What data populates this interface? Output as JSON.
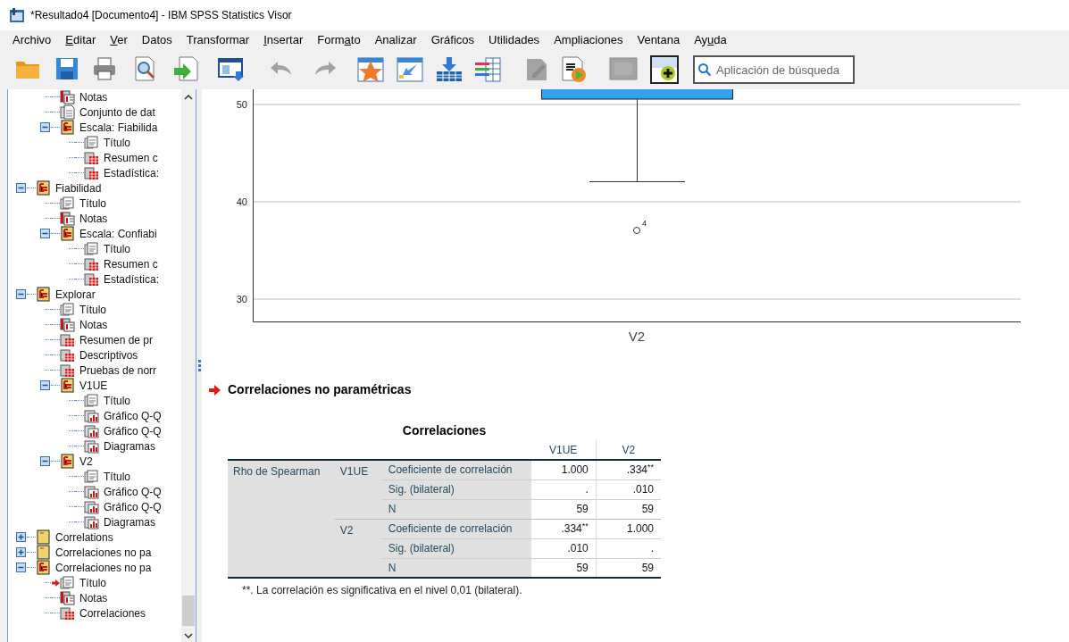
{
  "window": {
    "title": "*Resultado4 [Documento4] - IBM SPSS Statistics Visor"
  },
  "menu": [
    {
      "before": "Archivo"
    },
    {
      "key": "E",
      "after": "ditar"
    },
    {
      "key": "V",
      "after": "er"
    },
    {
      "before": "Datos"
    },
    {
      "before": "Transformar"
    },
    {
      "key": "I",
      "after": "nsertar"
    },
    {
      "before": "Form",
      "key": "a",
      "after": "to"
    },
    {
      "before": "Analizar"
    },
    {
      "before": "Gráficos"
    },
    {
      "before": "Utilidades"
    },
    {
      "before": "Ampliaciones"
    },
    {
      "before": "Ventana"
    },
    {
      "before": "Ay",
      "key": "u",
      "after": "da"
    }
  ],
  "toolbar": [
    {
      "kind": "open",
      "disabled": false
    },
    {
      "kind": "save",
      "disabled": false
    },
    {
      "kind": "print",
      "disabled": false
    },
    {
      "kind": "preview",
      "disabled": false
    },
    {
      "kind": "export",
      "disabled": false
    },
    {
      "kind": "window",
      "disabled": false
    },
    {
      "kind": "undo",
      "disabled": true
    },
    {
      "kind": "redo",
      "disabled": true
    },
    {
      "kind": "star",
      "disabled": false
    },
    {
      "kind": "goto",
      "disabled": false
    },
    {
      "kind": "insert",
      "disabled": false
    },
    {
      "kind": "variables",
      "disabled": false
    },
    {
      "kind": "edit",
      "disabled": true
    },
    {
      "kind": "script",
      "disabled": false
    },
    {
      "kind": "square",
      "disabled": true
    },
    {
      "kind": "add",
      "disabled": false
    }
  ],
  "search": {
    "placeholder": "Aplicación de búsqueda"
  },
  "tree": {
    "continued": [
      {
        "label": "Notas",
        "kind": "notes",
        "current": false
      },
      {
        "label": "Conjunto de dat",
        "kind": "page",
        "current": false
      },
      {
        "label": "Escala: Fiabilida",
        "kind": "node",
        "expanded": true,
        "current": false,
        "children": [
          {
            "label": "Título",
            "kind": "title",
            "current": false
          },
          {
            "label": "Resumen c",
            "kind": "table",
            "current": false
          },
          {
            "label": "Estadística:",
            "kind": "table",
            "current": false
          }
        ]
      }
    ],
    "nodes": [
      {
        "label": "Fiabilidad",
        "kind": "node",
        "expanded": true,
        "current": false,
        "children": [
          {
            "label": "Título",
            "kind": "title",
            "current": false
          },
          {
            "label": "Notas",
            "kind": "notes",
            "current": false
          },
          {
            "label": "Escala: Confiabi",
            "kind": "node",
            "expanded": true,
            "current": false,
            "children": [
              {
                "label": "Título",
                "kind": "title",
                "current": false
              },
              {
                "label": "Resumen c",
                "kind": "table",
                "current": false
              },
              {
                "label": "Estadística:",
                "kind": "table",
                "current": false
              }
            ]
          }
        ]
      },
      {
        "label": "Explorar",
        "kind": "node",
        "expanded": true,
        "current": false,
        "children": [
          {
            "label": "Título",
            "kind": "title",
            "current": false
          },
          {
            "label": "Notas",
            "kind": "notes",
            "current": false
          },
          {
            "label": "Resumen de pr",
            "kind": "table",
            "current": false
          },
          {
            "label": "Descriptivos",
            "kind": "table",
            "current": false
          },
          {
            "label": "Pruebas de norr",
            "kind": "table",
            "current": false
          },
          {
            "label": "V1UE",
            "kind": "node",
            "expanded": true,
            "current": false,
            "children": [
              {
                "label": "Título",
                "kind": "title",
                "current": false
              },
              {
                "label": "Gráfico Q-Q",
                "kind": "chart",
                "current": false
              },
              {
                "label": "Gráfico Q-Q",
                "kind": "chart",
                "current": false
              },
              {
                "label": "Diagramas",
                "kind": "chart",
                "current": false
              }
            ]
          },
          {
            "label": "V2",
            "kind": "node",
            "expanded": true,
            "current": false,
            "children": [
              {
                "label": "Título",
                "kind": "title",
                "current": false
              },
              {
                "label": "Gráfico Q-Q",
                "kind": "chart",
                "current": false
              },
              {
                "label": "Gráfico Q-Q",
                "kind": "chart",
                "current": false
              },
              {
                "label": "Diagramas",
                "kind": "chart",
                "current": false
              }
            ]
          }
        ]
      },
      {
        "label": "Correlations",
        "kind": "closed",
        "expanded": false,
        "current": false
      },
      {
        "label": "Correlaciones no pa",
        "kind": "closed",
        "expanded": false,
        "current": false
      },
      {
        "label": "Correlaciones no pa",
        "kind": "node",
        "expanded": true,
        "current": false,
        "children": [
          {
            "label": "Título",
            "kind": "title",
            "current": true
          },
          {
            "label": "Notas",
            "kind": "notes",
            "current": false
          },
          {
            "label": "Correlaciones",
            "kind": "table",
            "current": false
          }
        ]
      }
    ]
  },
  "boxplot": {
    "yticks": [
      "50",
      "40",
      "30"
    ],
    "category": "V2",
    "outlier_label": "4"
  },
  "section": {
    "heading": "Correlaciones no paramétricas"
  },
  "table": {
    "title": "Correlaciones",
    "columns": [
      "V1UE",
      "V2"
    ],
    "groups": [
      {
        "label": "Rho de Spearman",
        "variables": [
          {
            "label": "V1UE",
            "rows": [
              {
                "statistic": "Coeficiente de correlación",
                "values": [
                  "1.000",
                  ".334$^{**}$"
                ]
              },
              {
                "statistic": "Sig. (bilateral)",
                "values": [
                  ".",
                  ".010"
                ]
              },
              {
                "statistic": "N",
                "values": [
                  "59",
                  "59"
                ]
              }
            ]
          },
          {
            "label": "V2",
            "rows": [
              {
                "statistic": "Coeficiente de correlación",
                "values": [
                  ".334$^{**}$",
                  "1.000"
                ]
              },
              {
                "statistic": "Sig. (bilateral)",
                "values": [
                  ".010",
                  "."
                ]
              },
              {
                "statistic": "N",
                "values": [
                  "59",
                  "59"
                ]
              }
            ]
          }
        ]
      }
    ],
    "footnote": "**. La correlación es significativa en el nivel 0,01 (bilateral)."
  }
}
